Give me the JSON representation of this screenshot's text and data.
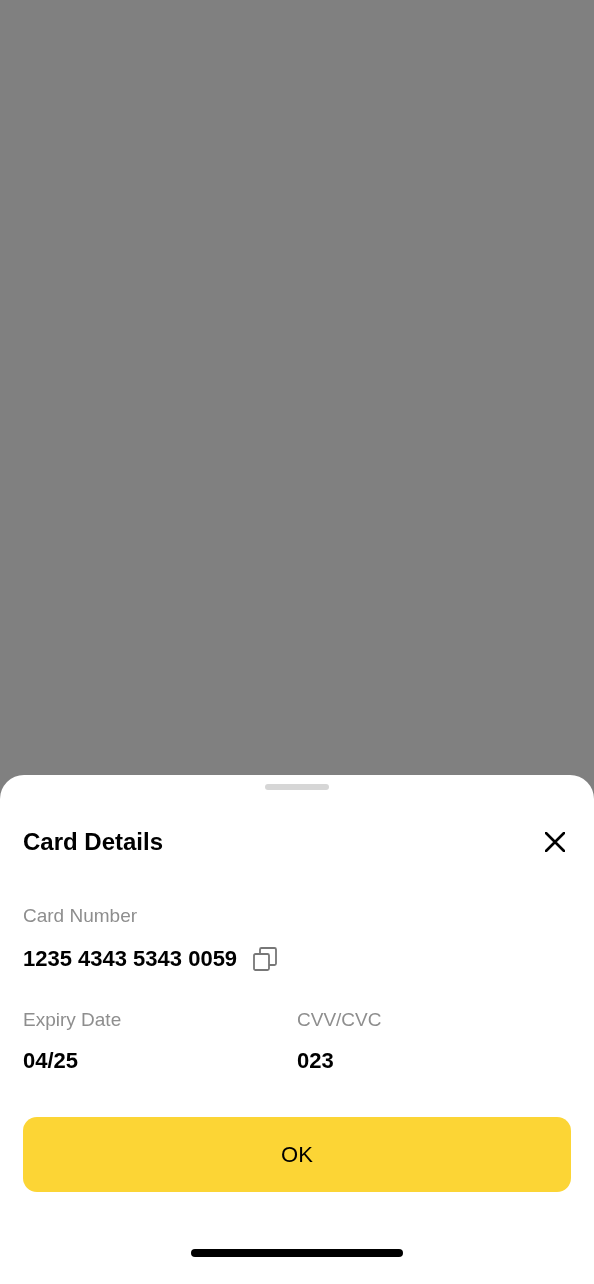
{
  "sheet": {
    "title": "Card Details",
    "card_number": {
      "label": "Card Number",
      "value": "1235 4343 5343 0059"
    },
    "details": [
      {
        "label": "Expiry Date",
        "value": "04/25"
      },
      {
        "label": "CVV/CVC",
        "value": "023"
      }
    ],
    "button": "OK"
  }
}
